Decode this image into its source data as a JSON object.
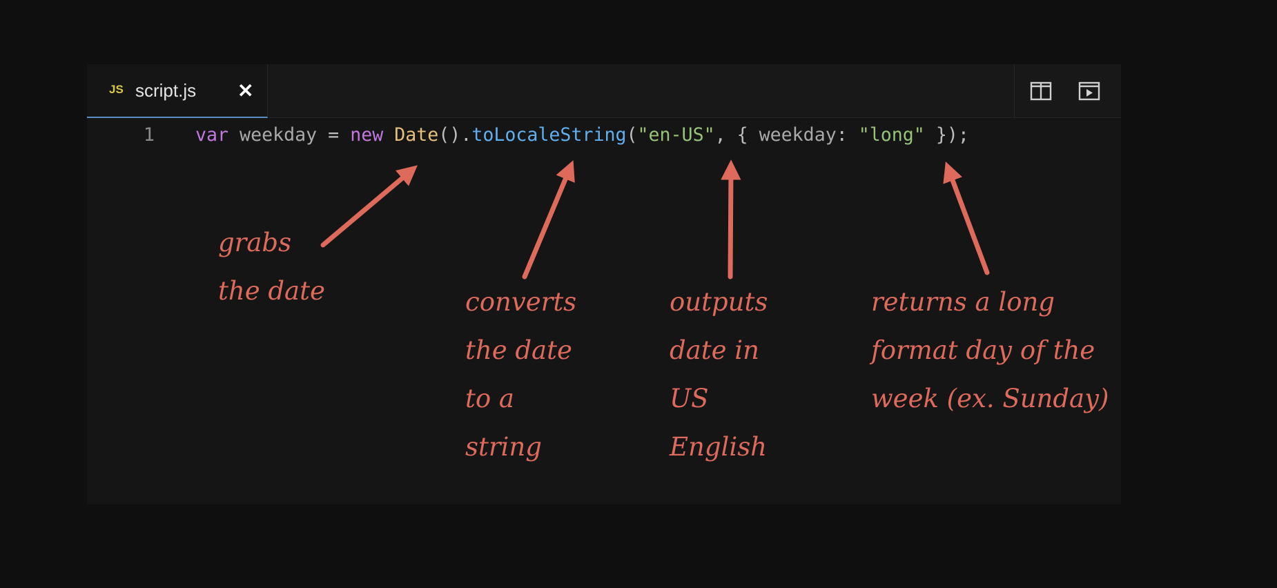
{
  "tab": {
    "lang_badge": "JS",
    "filename": "script.js",
    "close_glyph": "✕"
  },
  "actions": {
    "split_icon": "split-editor-icon",
    "preview_icon": "open-preview-icon"
  },
  "code": {
    "line_number": "1",
    "tokens": {
      "var": "var",
      "ident": " weekday ",
      "eq": "= ",
      "new": "new",
      "space1": " ",
      "date": "Date",
      "call": "().",
      "method": "toLocaleString",
      "open": "(",
      "locale": "\"en-US\"",
      "comma": ", { ",
      "key": "weekday",
      "colon": ": ",
      "value": "\"long\"",
      "close": " });"
    }
  },
  "annotations": {
    "grabs": "grabs\nthe date",
    "converts": "converts\nthe date\nto a\nstring",
    "outputs": "outputs\ndate in\nUS\nEnglish",
    "returns": "returns a long\nformat day of the\nweek (ex. Sunday)"
  },
  "colors": {
    "background": "#0f0f10",
    "editor": "#151515",
    "annotation": "#de6a5c",
    "tab_underline": "#5a8fc8"
  }
}
